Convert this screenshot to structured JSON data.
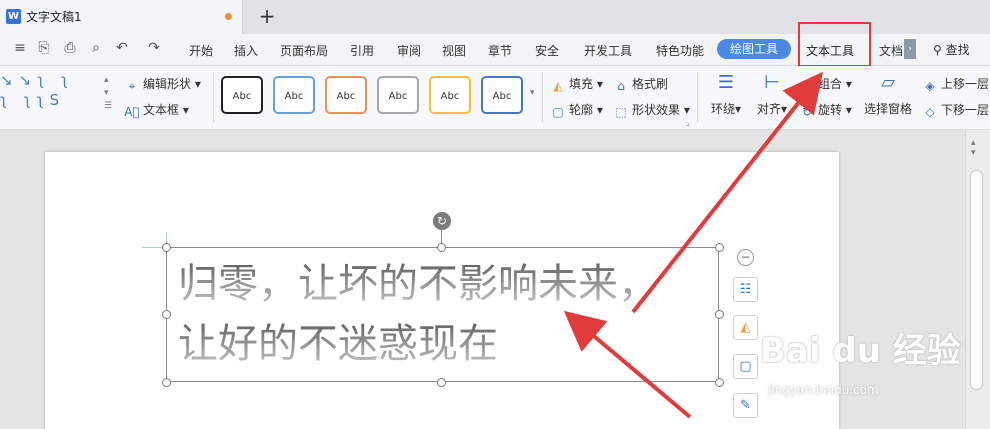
{
  "window": {
    "tab_icon": "W",
    "tab_title": "文字文稿1",
    "new_tab": "+"
  },
  "menubar": {
    "items": [
      "开始",
      "插入",
      "页面布局",
      "引用",
      "审阅",
      "视图",
      "章节",
      "安全",
      "开发工具",
      "特色功能"
    ],
    "drawing_tools": "绘图工具",
    "text_tools": "文本工具",
    "doc_partial": "文档",
    "find": "查找"
  },
  "ribbon": {
    "edit_shape": "编辑形状",
    "text_box": "文本框",
    "style_label": "Abc",
    "style_colors": [
      "#222222",
      "#6b9fd6",
      "#e4935a",
      "#a8a8a8",
      "#f0c23a",
      "#4a77b8"
    ],
    "fill": "填充",
    "outline": "轮廓",
    "format_painter": "格式刷",
    "shape_effect": "形状效果",
    "wrap": "环绕",
    "align": "对齐",
    "group": "组合",
    "rotate": "旋转",
    "selection_pane": "选择窗格",
    "bring_forward": "上移一层",
    "send_backward": "下移一层"
  },
  "document": {
    "line1": "归零，让坏的不影响未来，",
    "line2": "让好的不迷惑现在"
  },
  "watermark": {
    "brand": "Bai du 经验",
    "url": "jingyan.baidu.com"
  },
  "colors": {
    "accent": "#4b89e6",
    "highlight": "#e23b3b"
  }
}
